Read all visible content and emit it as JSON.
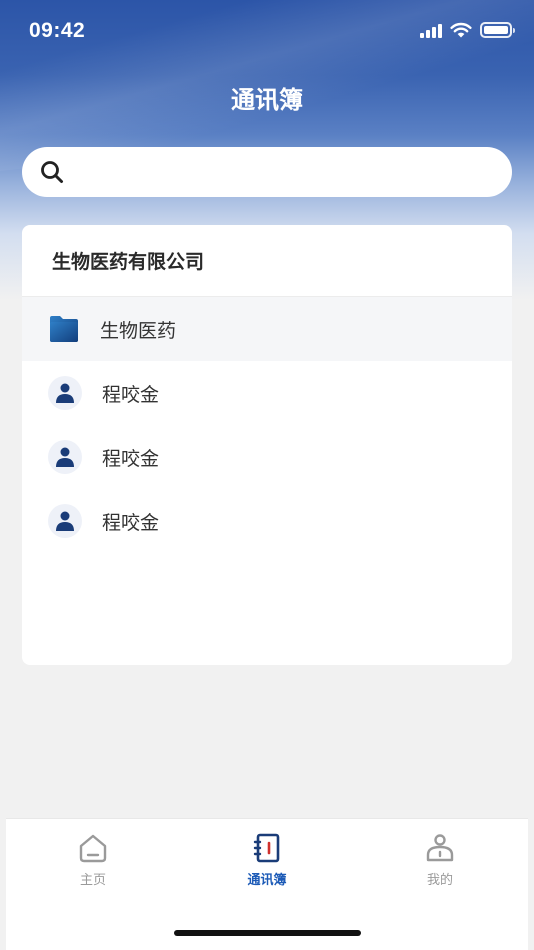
{
  "status_bar": {
    "time": "09:42"
  },
  "header": {
    "title": "通讯簿"
  },
  "search": {
    "placeholder": "",
    "value": ""
  },
  "directory": {
    "company_name": "生物医药有限公司",
    "department": {
      "name": "生物医药",
      "icon": "folder-icon"
    },
    "contacts": [
      {
        "name": "程咬金",
        "icon": "person-icon"
      },
      {
        "name": "程咬金",
        "icon": "person-icon"
      },
      {
        "name": "程咬金",
        "icon": "person-icon"
      }
    ]
  },
  "tabbar": {
    "tabs": [
      {
        "label": "主页",
        "icon": "home-icon",
        "active": false
      },
      {
        "label": "通讯簿",
        "icon": "address-book-icon",
        "active": true
      },
      {
        "label": "我的",
        "icon": "profile-icon",
        "active": false
      }
    ]
  },
  "colors": {
    "accent": "#1d5bb7",
    "header_gradient_top": "#2c55a8",
    "background": "#f1f1f1",
    "folder": "#1f5fa0",
    "avatar_figure": "#1a3c78",
    "tab_inactive": "#9a9a9a"
  }
}
